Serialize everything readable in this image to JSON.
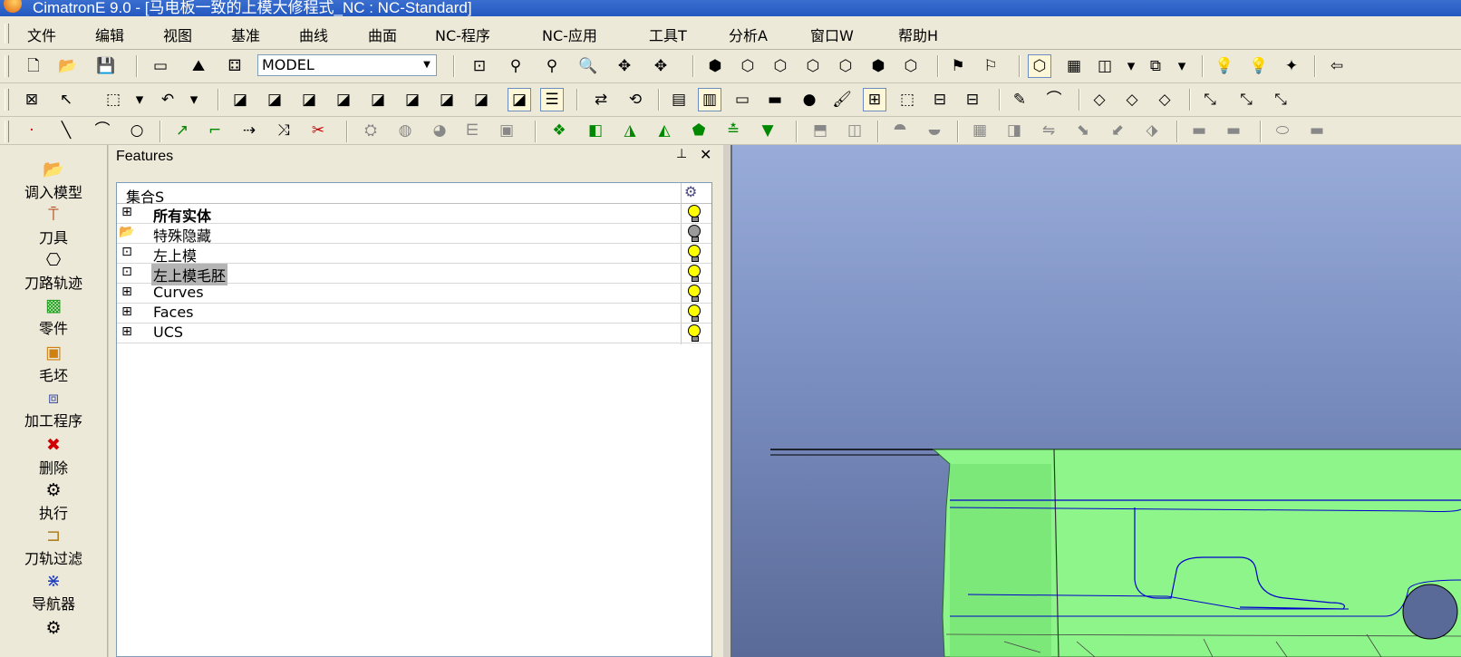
{
  "window": {
    "title": "CimatronE 9.0 - [马电板一致的上模大修程式_NC : NC-Standard]"
  },
  "menu": [
    "文件",
    "编辑",
    "视图",
    "基准",
    "曲线",
    "曲面",
    "NC-程序",
    "NC-应用",
    "工具T",
    "分析A",
    "窗口W",
    "帮助H"
  ],
  "toolbar": {
    "model_combo": "MODEL"
  },
  "left_toolbar": {
    "items": [
      {
        "label": "调入模型",
        "icon": "load-model-icon"
      },
      {
        "label": "刀具",
        "icon": "tool-icon"
      },
      {
        "label": "刀路轨迹",
        "icon": "toolpath-icon"
      },
      {
        "label": "零件",
        "icon": "part-icon"
      },
      {
        "label": "毛坯",
        "icon": "stock-icon"
      },
      {
        "label": "加工程序",
        "icon": "procedure-icon"
      },
      {
        "label": "删除",
        "icon": "delete-icon"
      },
      {
        "label": "执行",
        "icon": "execute-icon"
      },
      {
        "label": "刀轨过滤",
        "icon": "filter-icon"
      },
      {
        "label": "导航器",
        "icon": "navigator-icon"
      }
    ]
  },
  "features_panel": {
    "title": "Features",
    "header": "集合S",
    "rows": [
      {
        "label": "所有实体",
        "bold": true,
        "bulb": "on"
      },
      {
        "label": "特殊隐藏",
        "bold": false,
        "bulb": "off"
      },
      {
        "label": "左上模",
        "bold": false,
        "bulb": "on"
      },
      {
        "label": "左上模毛胚",
        "bold": false,
        "bulb": "on",
        "selected": true
      },
      {
        "label": "Curves",
        "bold": false,
        "bulb": "on"
      },
      {
        "label": "Faces",
        "bold": false,
        "bulb": "on"
      },
      {
        "label": "UCS",
        "bold": false,
        "bulb": "on"
      }
    ]
  },
  "colors": {
    "title_bar": "#2458c0",
    "viewport_top": "#99acd9",
    "viewport_bottom": "#5a6a98",
    "model_fill": "#8ef58a",
    "model_edges": "#0000cc",
    "selection": "#b4b4b4"
  }
}
